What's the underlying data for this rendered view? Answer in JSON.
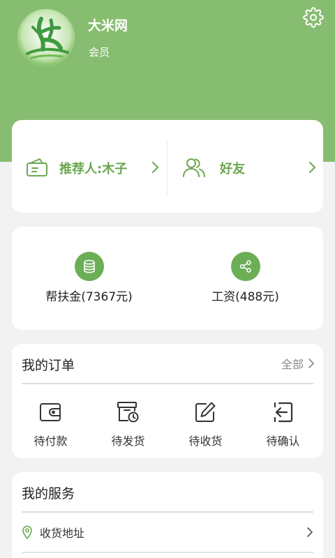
{
  "colors": {
    "brand_green": "#87bd70",
    "accent_green": "#6ba64f",
    "icon_green": "#6cae56"
  },
  "profile": {
    "name": "大米网",
    "level": "会员",
    "logo_icon": "rice-logo-icon",
    "settings_icon": "gear-icon"
  },
  "referral": {
    "referrer_label": "推荐人:木子",
    "friends_label": "好友"
  },
  "wallet": {
    "aid_fund_label": "帮扶金(7367元)",
    "salary_label": "工资(488元)"
  },
  "orders": {
    "title": "我的订单",
    "all_label": "全部",
    "items": [
      {
        "label": "待付款",
        "icon": "wallet-icon"
      },
      {
        "label": "待发货",
        "icon": "box-clock-icon"
      },
      {
        "label": "待收货",
        "icon": "edit-icon"
      },
      {
        "label": "待确认",
        "icon": "enter-icon"
      }
    ]
  },
  "services": {
    "title": "我的服务",
    "items": [
      {
        "label": "收货地址",
        "icon": "location-pin-icon"
      }
    ]
  }
}
